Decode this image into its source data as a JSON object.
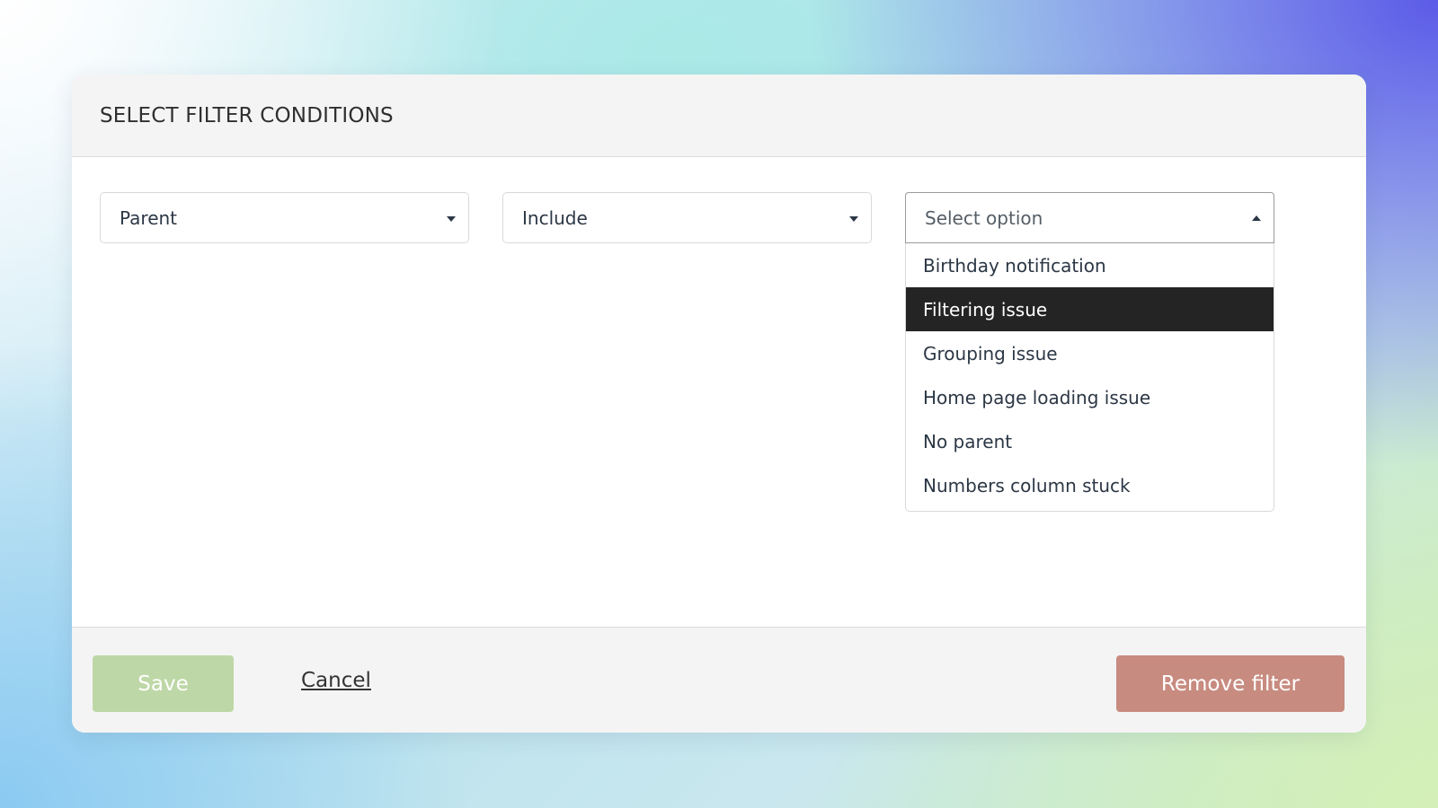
{
  "dialog": {
    "title": "SELECT FILTER CONDITIONS"
  },
  "filters": {
    "field": {
      "value": "Parent"
    },
    "operator": {
      "value": "Include"
    },
    "option": {
      "placeholder": "Select option",
      "open": true,
      "highlighted_index": 1,
      "items": [
        {
          "label": "Birthday notification"
        },
        {
          "label": "Filtering issue"
        },
        {
          "label": "Grouping issue"
        },
        {
          "label": "Home page loading issue"
        },
        {
          "label": "No parent"
        },
        {
          "label": "Numbers column stuck"
        }
      ]
    }
  },
  "footer": {
    "save_label": "Save",
    "cancel_label": "Cancel",
    "remove_label": "Remove filter"
  },
  "colors": {
    "save_button": "#bed7a6",
    "remove_button": "#c88b80",
    "highlight": "#242424"
  },
  "icons": {
    "caret_down": "caret-down-icon",
    "caret_up": "caret-up-icon"
  }
}
